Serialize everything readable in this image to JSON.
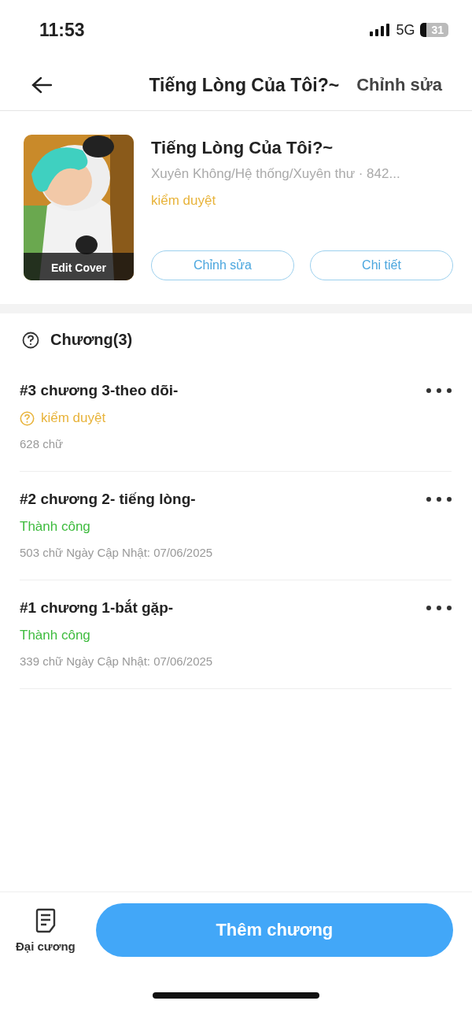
{
  "status_bar": {
    "time": "11:53",
    "network": "5G",
    "battery": "31"
  },
  "header": {
    "title": "Tiếng Lòng Của Tôi?~",
    "action": "Chỉnh sửa"
  },
  "book": {
    "cover": {
      "kind": "picture",
      "label": "Edit Cover"
    },
    "title": "Tiếng Lòng Của Tôi?~",
    "meta": "Xuyên Không/Hệ thống/Xuyên thư · 842...",
    "status": "kiểm duyệt",
    "buttons": [
      "Chỉnh sửa",
      "Chi tiết"
    ]
  },
  "section": {
    "title": "Chương(3)"
  },
  "chapters": [
    {
      "title": "#3 chương 3-theo dõi-",
      "kind": "review",
      "status": "kiểm duyệt",
      "info": "628 chữ"
    },
    {
      "title": "#2 chương 2- tiếng lòng-",
      "kind": "success",
      "status": "Thành công",
      "info": "503 chữ Ngày Cập Nhật: 07/06/2025"
    },
    {
      "title": "#1 chương 1-bắt gặp-",
      "kind": "success",
      "status": "Thành công",
      "info": "339 chữ Ngày Cập Nhật: 07/06/2025"
    }
  ],
  "bottom_bar": {
    "outline": "Đại cương",
    "add_button": "Thêm chương"
  }
}
